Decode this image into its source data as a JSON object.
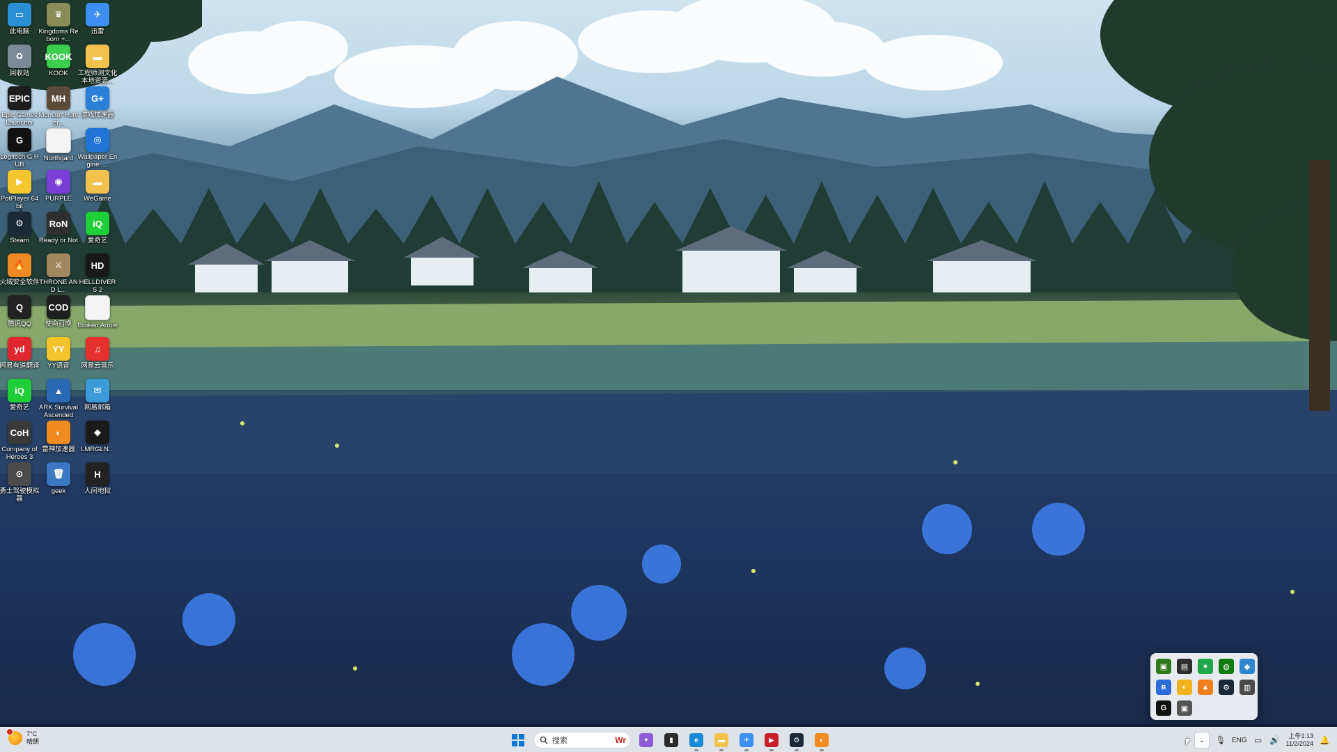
{
  "desktop": {
    "icons": [
      {
        "label": "此电脑",
        "icon": "computer-icon",
        "color": "#2b8fd6",
        "glyph": "▭"
      },
      {
        "label": "Kingdoms Reborn +...",
        "icon": "kingdoms-reborn-icon",
        "color": "#8a8d5a",
        "glyph": "♛"
      },
      {
        "label": "迅雷",
        "icon": "thunder-bird-icon",
        "color": "#3b8ff0",
        "glyph": "✈"
      },
      {
        "label": "回收站",
        "icon": "recycle-bin-icon",
        "color": "#7b8a96",
        "glyph": "♻"
      },
      {
        "label": "KOOK",
        "icon": "kook-icon",
        "color": "#3ccf4e",
        "glyph": "KOOK"
      },
      {
        "label": "工程师测文化本地资源...",
        "icon": "folder-icon",
        "color": "#f2c14e",
        "glyph": "▬"
      },
      {
        "label": "Epic Games Launcher",
        "icon": "epic-games-icon",
        "color": "#1d1d1d",
        "glyph": "EPIC"
      },
      {
        "label": "Monster Hunter...",
        "icon": "monster-hunter-icon",
        "color": "#5a4a3a",
        "glyph": "MH"
      },
      {
        "label": "游戏加速器",
        "icon": "game-booster-icon",
        "color": "#2a7fd8",
        "glyph": "G+"
      },
      {
        "label": "Logitech G HUB",
        "icon": "logitech-ghub-icon",
        "color": "#111111",
        "glyph": "G"
      },
      {
        "label": "Northgard",
        "icon": "document-icon",
        "color": "#f4f4f4",
        "glyph": ""
      },
      {
        "label": "Wallpaper Engine: ...",
        "icon": "wallpaper-engine-icon",
        "color": "#1f74d6",
        "glyph": "◎"
      },
      {
        "label": "PotPlayer 64 bit",
        "icon": "potplayer-icon",
        "color": "#f2c62c",
        "glyph": "▶"
      },
      {
        "label": "PURPLE",
        "icon": "purple-icon",
        "color": "#7b3fd8",
        "glyph": "◉"
      },
      {
        "label": "WeGame",
        "icon": "folder-icon",
        "color": "#f2c14e",
        "glyph": "▬"
      },
      {
        "label": "Steam",
        "icon": "steam-icon",
        "color": "#1b2838",
        "glyph": "⚙"
      },
      {
        "label": "Ready or Not",
        "icon": "ready-or-not-icon",
        "color": "#2e2e2e",
        "glyph": "RoN"
      },
      {
        "label": "爱奇艺",
        "icon": "iqiyi-icon",
        "color": "#1fcf3a",
        "glyph": "iQ"
      },
      {
        "label": "火绒安全软件",
        "icon": "huorong-icon",
        "color": "#f08a24",
        "glyph": "🔥"
      },
      {
        "label": "THRONE AND L...",
        "icon": "throne-and-liberty-icon",
        "color": "#a28660",
        "glyph": "⚔"
      },
      {
        "label": "HELLDIVERS 2",
        "icon": "helldivers-icon",
        "color": "#181818",
        "glyph": "HD"
      },
      {
        "label": "腾讯QQ",
        "icon": "qq-icon",
        "color": "#222222",
        "glyph": "Q"
      },
      {
        "label": "使命召唤",
        "icon": "call-of-duty-icon",
        "color": "#1e1e1e",
        "glyph": "COD"
      },
      {
        "label": "Broken Arrow",
        "icon": "document-icon",
        "color": "#f4f4f4",
        "glyph": ""
      },
      {
        "label": "网易有道翻译",
        "icon": "youdao-icon",
        "color": "#e0262f",
        "glyph": "yd"
      },
      {
        "label": "YY语音",
        "icon": "yy-icon",
        "color": "#f4c42a",
        "glyph": "YY"
      },
      {
        "label": "网易云音乐",
        "icon": "netease-music-icon",
        "color": "#e4312b",
        "glyph": "♫"
      },
      {
        "label": "爱奇艺",
        "icon": "iqiyi-icon",
        "color": "#1fcf3a",
        "glyph": "iQ"
      },
      {
        "label": "ARK Survival Ascended",
        "icon": "ark-icon",
        "color": "#2a6ab5",
        "glyph": "▲"
      },
      {
        "label": "网易邮箱",
        "icon": "mail-icon",
        "color": "#3b9bdb",
        "glyph": "✉"
      },
      {
        "label": "Company of Heroes 3",
        "icon": "coh3-icon",
        "color": "#3a3a3a",
        "glyph": "CoH"
      },
      {
        "label": "雷神加速器",
        "icon": "leishen-icon",
        "color": "#f08b1f",
        "glyph": "◐"
      },
      {
        "label": "LMRGLN...",
        "icon": "lmrgln-icon",
        "color": "#1a1a1a",
        "glyph": "◆"
      },
      {
        "label": "勇士驾驶模拟器",
        "icon": "driving-icon",
        "color": "#4a4a4a",
        "glyph": "⊙"
      },
      {
        "label": "geek",
        "icon": "geek-uninstaller-icon",
        "color": "#3a78c2",
        "glyph": "🗑"
      },
      {
        "label": "人间地狱",
        "icon": "hell-let-loose-icon",
        "color": "#222222",
        "glyph": "H"
      }
    ]
  },
  "tray_popup": {
    "icons": [
      {
        "name": "nvidia-icon",
        "color": "#2f7a1c",
        "glyph": "▣"
      },
      {
        "name": "app-icon",
        "color": "#2d2d2d",
        "glyph": "▤"
      },
      {
        "name": "green-app-icon",
        "color": "#1fa84a",
        "glyph": "●"
      },
      {
        "name": "xbox-icon",
        "color": "#107c10",
        "glyph": "◍"
      },
      {
        "name": "network-app-icon",
        "color": "#2f86d1",
        "glyph": "◆"
      },
      {
        "name": "bluetooth-icon",
        "color": "#2b6cd8",
        "glyph": "ʙ"
      },
      {
        "name": "orange-app-icon",
        "color": "#f2b21c",
        "glyph": "◐"
      },
      {
        "name": "huorong-tray-icon",
        "color": "#ef7f1f",
        "glyph": "▲"
      },
      {
        "name": "steam-tray-icon",
        "color": "#1b2838",
        "glyph": "⚙"
      },
      {
        "name": "tray-app-icon",
        "color": "#4a4a4a",
        "glyph": "▥"
      },
      {
        "name": "logitech-tray-icon",
        "color": "#111111",
        "glyph": "G"
      },
      {
        "name": "display-app-icon",
        "color": "#555555",
        "glyph": "▣"
      }
    ]
  },
  "taskbar": {
    "weather_temp": "7°C",
    "weather_desc": "晴朗",
    "search_placeholder": "搜索",
    "search_deco": "Wr",
    "apps": [
      {
        "name": "copilot-icon",
        "color": "#8e5bd8",
        "glyph": "✦"
      },
      {
        "name": "task-view-icon",
        "color": "#2b2b2b",
        "glyph": "▮"
      },
      {
        "name": "edge-icon",
        "color": "#1a8ad8",
        "glyph": "e"
      },
      {
        "name": "file-explorer-icon",
        "color": "#f2c14e",
        "glyph": "▬"
      },
      {
        "name": "thunder-taskbar-icon",
        "color": "#3b8ff0",
        "glyph": "✈"
      },
      {
        "name": "video-app-icon",
        "color": "#c81e2a",
        "glyph": "▶"
      },
      {
        "name": "steam-taskbar-icon",
        "color": "#1b2838",
        "glyph": "⚙"
      },
      {
        "name": "leishen-taskbar-icon",
        "color": "#f08b1f",
        "glyph": "◐"
      }
    ],
    "lang": "ENG",
    "time": "上午1:13",
    "date": "11/2/2024"
  }
}
